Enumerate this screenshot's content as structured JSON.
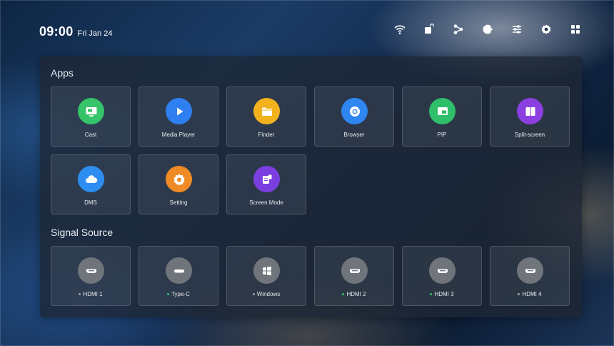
{
  "status": {
    "time": "09:00",
    "date": "Fri Jan 24",
    "icons": [
      "wifi-icon",
      "screen-lock-icon",
      "share-icon",
      "eye-protection-icon",
      "adjust-icon",
      "settings-icon",
      "apps-grid-icon"
    ]
  },
  "apps": {
    "title": "Apps",
    "items": [
      {
        "label": "Cast",
        "icon": "cast-icon",
        "color": "#35c46a"
      },
      {
        "label": "Media Player",
        "icon": "play-icon",
        "color": "#2f7ff0"
      },
      {
        "label": "Finder",
        "icon": "folder-icon",
        "color": "#f2b21e"
      },
      {
        "label": "Browser",
        "icon": "browser-icon",
        "color": "#2f86f0"
      },
      {
        "label": "PIP",
        "icon": "pip-icon",
        "color": "#2fbe6a"
      },
      {
        "label": "Split-screen",
        "icon": "split-screen-icon",
        "color": "#8c3fe0"
      },
      {
        "label": "DMS",
        "icon": "cloud-icon",
        "color": "#2d8df0"
      },
      {
        "label": "Setting",
        "icon": "gear-icon",
        "color": "#f08a25"
      },
      {
        "label": "Screen Mode",
        "icon": "screen-mode-icon",
        "color": "#7b3fe0"
      }
    ]
  },
  "signal": {
    "title": "Signal Source",
    "items": [
      {
        "label": "HDMI 1",
        "icon": "hdmi-icon",
        "dot": "#9aa0a8"
      },
      {
        "label": "Type-C",
        "icon": "hdmi-icon",
        "dot": "#35c46a"
      },
      {
        "label": "Windows",
        "icon": "windows-icon",
        "dot": "#9aa0a8"
      },
      {
        "label": "HDMI 2",
        "icon": "hdmi-icon",
        "dot": "#35c46a"
      },
      {
        "label": "HDMI 3",
        "icon": "hdmi-icon",
        "dot": "#35c46a"
      },
      {
        "label": "HDMI 4",
        "icon": "hdmi-icon",
        "dot": "#9aa0a8"
      }
    ]
  }
}
